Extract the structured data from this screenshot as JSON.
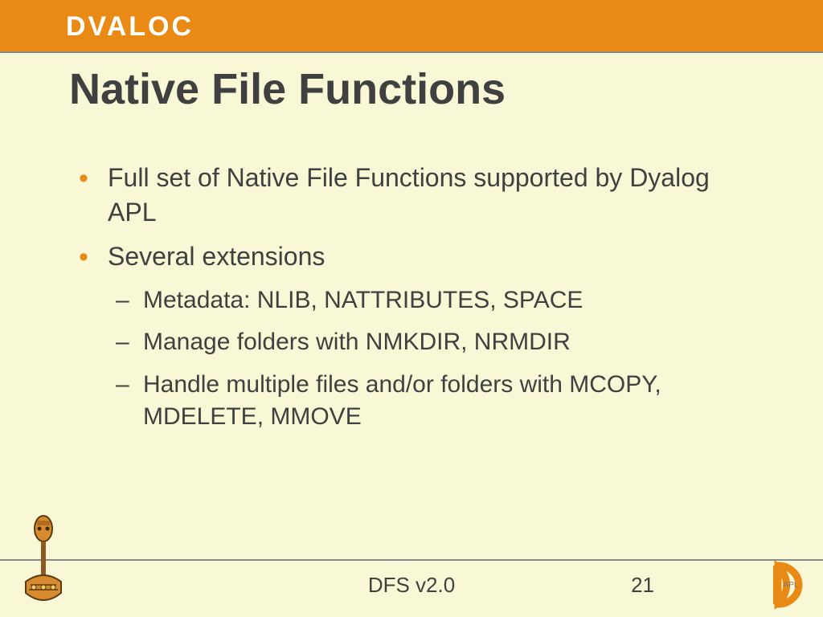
{
  "header": {
    "logo": "DVALOC"
  },
  "title": "Native File Functions",
  "bullets": {
    "b1": "Full set of Native File Functions supported by Dyalog APL",
    "b2": "Several extensions",
    "b2a": "Metadata: NLIB, NATTRIBUTES, SPACE",
    "b2b": "Manage folders with NMKDIR, NRMDIR",
    "b2c": "Handle multiple files and/or folders with MCOPY, MDELETE, MMOVE"
  },
  "footer": {
    "center": "DFS v2.0",
    "page": "21",
    "corner_label": "APL"
  }
}
